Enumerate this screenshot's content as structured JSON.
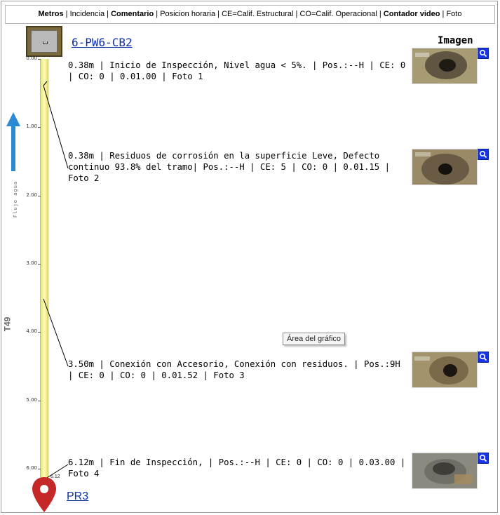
{
  "header": {
    "metros": "Metros",
    "incidencia": "Incidencia",
    "comentario": "Comentario",
    "posicion": "Posicion horaria",
    "ce": "CE=Calif. Estructural",
    "co": "CO=Calif. Operacional",
    "contador": "Contador video",
    "foto": "Foto",
    "sep": " | "
  },
  "start_node": {
    "label": "6-PW6-CB2"
  },
  "end_node": {
    "label": "PR3",
    "end_value": "6.12"
  },
  "pipe": {
    "id": "T49",
    "flow_label": "Flujo agua"
  },
  "axis": {
    "ticks": [
      "0.00",
      "1.00",
      "2.00",
      "3.00",
      "4.00",
      "5.00",
      "6.00"
    ],
    "max": 6.12
  },
  "image_column_title": "Imagen",
  "tooltip": "Área del gráfico",
  "observations": [
    {
      "distance_m": 0.38,
      "text": "0.38m | Inicio de Inspección, Nivel agua < 5%. | Pos.:--H | CE: 0 | CO: 0 | 0.01.00 | Foto 1"
    },
    {
      "distance_m": 0.38,
      "text": "0.38m | Residuos de corrosión en la superficie Leve, Defecto continuo 93.8% del tramo| Pos.:--H | CE: 5 | CO: 0 | 0.01.15 | Foto 2"
    },
    {
      "distance_m": 3.5,
      "text": "3.50m | Conexión con Accesorio, Conexión con residuos. | Pos.:9H | CE: 0 | CO: 0 | 0.01.52 | Foto 3"
    },
    {
      "distance_m": 6.12,
      "text": "6.12m | Fin de Inspección, | Pos.:--H | CE: 0 | CO: 0 | 0.03.00 | Foto 4"
    }
  ],
  "colors": {
    "pipe": "#f6f19a",
    "link": "#0b2fa6",
    "zoom_button": "#1733e6",
    "flow_arrow": "#2a8bd4",
    "pin": "#c62828"
  },
  "icons": [
    "manhole-cover-icon",
    "flow-arrow-icon",
    "zoom-icon",
    "location-pin-icon"
  ]
}
